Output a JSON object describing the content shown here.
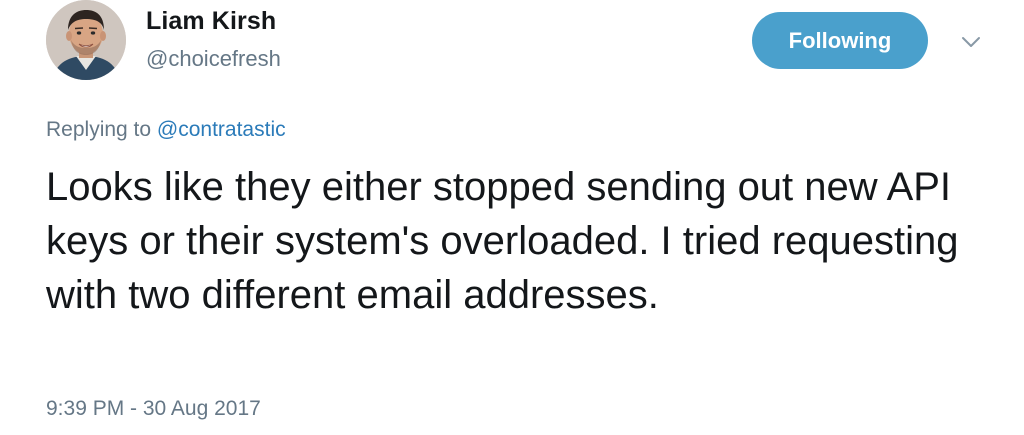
{
  "tweet": {
    "user": {
      "display_name": "Liam Kirsh",
      "handle": "@choicefresh",
      "avatar_icon": "profile-photo"
    },
    "follow_button": {
      "label": "Following",
      "color": "#4aa0cc"
    },
    "menu_icon": "chevron-down-icon",
    "reply": {
      "prefix": "Replying to",
      "mention": "@contratastic"
    },
    "text": "Looks like they either stopped sending out new API keys or their system's overloaded. I tried requesting with two different email addresses.",
    "timestamp": "9:39 PM - 30 Aug 2017"
  }
}
